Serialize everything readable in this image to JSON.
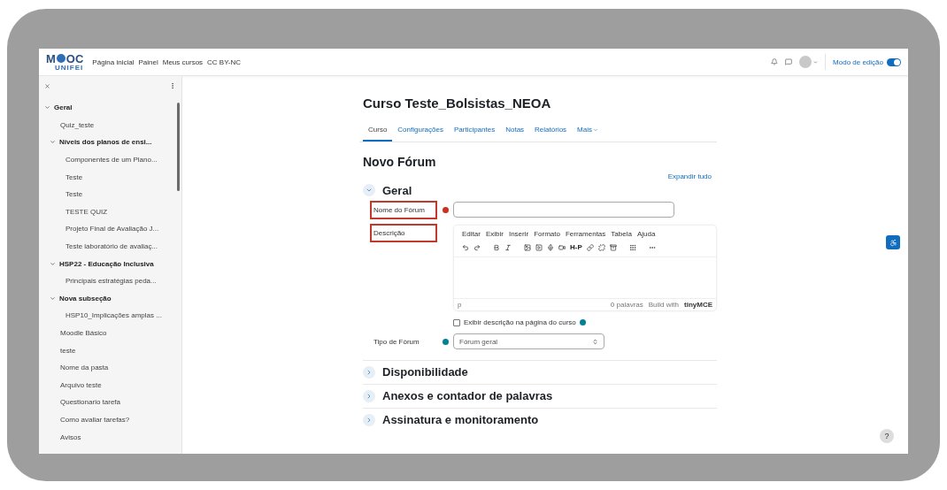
{
  "navbar": {
    "logo": {
      "left": "M",
      "right": "OC",
      "sub": "UNIFEI"
    },
    "links": [
      "Página inicial",
      "Painel",
      "Meus cursos",
      "CC BY-NC"
    ],
    "edit_mode": {
      "label": "Modo de edição",
      "on": true
    }
  },
  "sidebar": {
    "items": [
      {
        "label": "Geral",
        "kind": "section",
        "expanded": true,
        "children": [
          {
            "label": "Quiz_teste",
            "kind": "activity"
          },
          {
            "label": "Níveis dos planos de ensi...",
            "kind": "section",
            "expanded": true,
            "children": [
              {
                "label": "Componentes de um Plano...",
                "kind": "activity"
              },
              {
                "label": "Teste",
                "kind": "activity"
              },
              {
                "label": "Teste",
                "kind": "activity"
              },
              {
                "label": "TESTE QUIZ",
                "kind": "activity"
              },
              {
                "label": "Projeto Final de Avaliação J...",
                "kind": "activity"
              },
              {
                "label": "Teste laboratório de avaliaç...",
                "kind": "activity"
              }
            ]
          },
          {
            "label": "HSP22 - Educação Inclusiva",
            "kind": "section",
            "expanded": true,
            "children": [
              {
                "label": "Principais estratégias peda...",
                "kind": "activity"
              }
            ]
          },
          {
            "label": "Nova subseção",
            "kind": "section",
            "expanded": true,
            "children": [
              {
                "label": "HSP10_Implicações amplas ...",
                "kind": "activity"
              }
            ]
          },
          {
            "label": "Moodle Básico",
            "kind": "activity"
          },
          {
            "label": "teste",
            "kind": "activity"
          },
          {
            "label": "Nome da pasta",
            "kind": "activity"
          },
          {
            "label": "Arquivo teste",
            "kind": "activity"
          },
          {
            "label": "Questionario tarefa",
            "kind": "activity"
          },
          {
            "label": "Como avaliar tarefas?",
            "kind": "activity"
          },
          {
            "label": "Avisos",
            "kind": "activity"
          }
        ]
      }
    ]
  },
  "course_title": "Curso Teste_Bolsistas_NEOA",
  "tabs": [
    {
      "label": "Curso",
      "selected": true,
      "dropdown": false
    },
    {
      "label": "Configurações",
      "selected": false,
      "dropdown": false
    },
    {
      "label": "Participantes",
      "selected": false,
      "dropdown": false
    },
    {
      "label": "Notas",
      "selected": false,
      "dropdown": false
    },
    {
      "label": "Relatórios",
      "selected": false,
      "dropdown": false
    },
    {
      "label": "Mais",
      "selected": false,
      "dropdown": true
    }
  ],
  "page_title": "Novo Fórum",
  "expand_all": "Expandir tudo",
  "form": {
    "section_title": "Geral",
    "expanded": true,
    "fields": [
      {
        "kind": "text",
        "label": "Nome do Fórum",
        "highlighted": true,
        "required": true,
        "help": false
      },
      {
        "kind": "editor",
        "label": "Descrição",
        "highlighted": true,
        "required": false,
        "help": false,
        "menu": [
          "Editar",
          "Exibir",
          "Inserir",
          "Formato",
          "Ferramentas",
          "Tabela",
          "Ajuda"
        ],
        "h5p": "H-P",
        "status_path": "p",
        "word_count": "0 palavras",
        "credit": "Build with",
        "brand": "tinyMCE",
        "checkbox": {
          "label": "Exibir descrição na página do curso",
          "checked": false,
          "help": true
        }
      },
      {
        "kind": "select",
        "label": "Tipo de Fórum",
        "highlighted": false,
        "required": false,
        "help": true,
        "value": "Fórum geral"
      }
    ]
  },
  "collapsed_sections": [
    {
      "title": "Disponibilidade",
      "expanded": false
    },
    {
      "title": "Anexos e contador de palavras",
      "expanded": false
    },
    {
      "title": "Assinatura e monitoramento",
      "expanded": false
    }
  ],
  "help_button": "?"
}
